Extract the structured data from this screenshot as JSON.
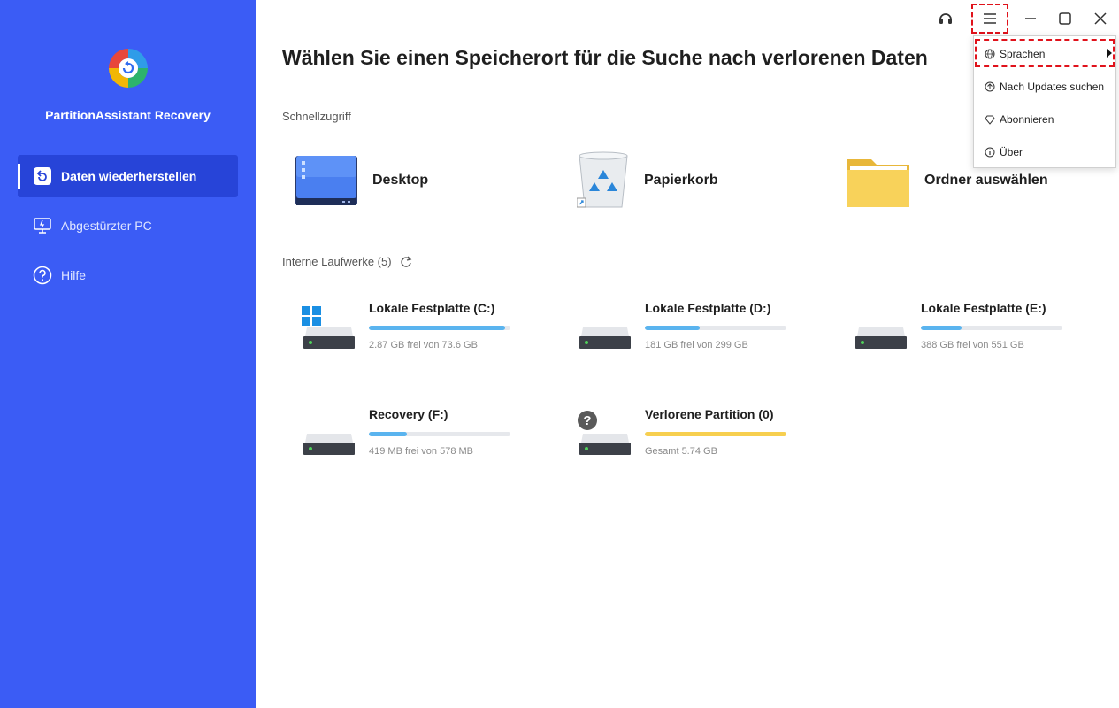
{
  "app": {
    "name": "PartitionAssistant Recovery"
  },
  "sidebar": {
    "items": [
      {
        "label": "Daten wiederherstellen",
        "icon": "restore-icon",
        "active": true
      },
      {
        "label": "Abgestürzter PC",
        "icon": "monitor-icon",
        "active": false
      },
      {
        "label": "Hilfe",
        "icon": "help-icon",
        "active": false
      }
    ]
  },
  "main": {
    "title": "Wählen Sie einen Speicherort für die Suche nach verlorenen Daten",
    "quick_access": {
      "label": "Schnellzugriff",
      "items": [
        {
          "label": "Desktop",
          "icon": "desktop-icon"
        },
        {
          "label": "Papierkorb",
          "icon": "recycle-bin-icon"
        },
        {
          "label": "Ordner auswählen",
          "icon": "folder-icon"
        }
      ]
    },
    "drives": {
      "label": "Interne Laufwerke (5)",
      "items": [
        {
          "name": "Lokale Festplatte (C:)",
          "info": "2.87 GB frei von 73.6 GB",
          "used_fraction": 0.96,
          "bar_color": "#5ab4ef",
          "windows": true
        },
        {
          "name": "Lokale Festplatte (D:)",
          "info": "181 GB frei von 299 GB",
          "used_fraction": 0.39,
          "bar_color": "#5ab4ef"
        },
        {
          "name": "Lokale Festplatte (E:)",
          "info": "388 GB frei von 551 GB",
          "used_fraction": 0.29,
          "bar_color": "#5ab4ef"
        },
        {
          "name": "Recovery (F:)",
          "info": "419 MB frei von 578 MB",
          "used_fraction": 0.27,
          "bar_color": "#5ab4ef"
        },
        {
          "name": "Verlorene Partition (0)",
          "info": "Gesamt 5.74 GB",
          "used_fraction": 1.0,
          "bar_color": "#f7cf4f",
          "lost": true
        }
      ]
    }
  },
  "menu": {
    "items": [
      {
        "label": "Sprachen",
        "icon": "globe-icon",
        "submenu": true
      },
      {
        "label": "Nach Updates suchen",
        "icon": "update-icon"
      },
      {
        "label": "Abonnieren",
        "icon": "diamond-icon"
      },
      {
        "label": "Über",
        "icon": "info-icon"
      }
    ]
  },
  "colors": {
    "sidebar": "#3b5cf5",
    "sidebar_active": "#2744d8",
    "highlight": "#e0121b"
  }
}
